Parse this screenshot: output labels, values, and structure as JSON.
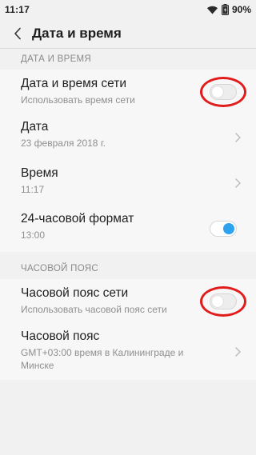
{
  "status_bar": {
    "time": "11:17",
    "battery": "90%",
    "icons": [
      "wifi-icon",
      "battery-charging-icon"
    ]
  },
  "header": {
    "back_icon": "chevron-left-icon",
    "title": "Дата и время"
  },
  "sections": [
    {
      "title": "ДАТА И ВРЕМЯ",
      "items": [
        {
          "title": "Дата и время сети",
          "subtitle": "Использовать время сети",
          "control": "toggle",
          "state": "off",
          "highlighted": true
        },
        {
          "title": "Дата",
          "subtitle": "23 февраля 2018 г.",
          "control": "chevron"
        },
        {
          "title": "Время",
          "subtitle": "11:17",
          "control": "chevron"
        },
        {
          "title": "24-часовой формат",
          "subtitle": "13:00",
          "control": "toggle",
          "state": "on"
        }
      ]
    },
    {
      "title": "ЧАСОВОЙ ПОЯС",
      "items": [
        {
          "title": "Часовой пояс сети",
          "subtitle": "Использовать часовой пояс сети",
          "control": "toggle",
          "state": "off",
          "highlighted": true
        },
        {
          "title": "Часовой пояс",
          "subtitle": "GMT+03:00 время в Калининграде и Минске",
          "control": "chevron"
        }
      ]
    }
  ],
  "colors": {
    "background": "#f1f1f1",
    "group_background": "#f7f7f7",
    "toggle_on": "#2da3f0",
    "highlight_ring": "#e21b1b",
    "section_header_text": "#8a8a8a",
    "subtitle_text": "#8f8f8f"
  }
}
